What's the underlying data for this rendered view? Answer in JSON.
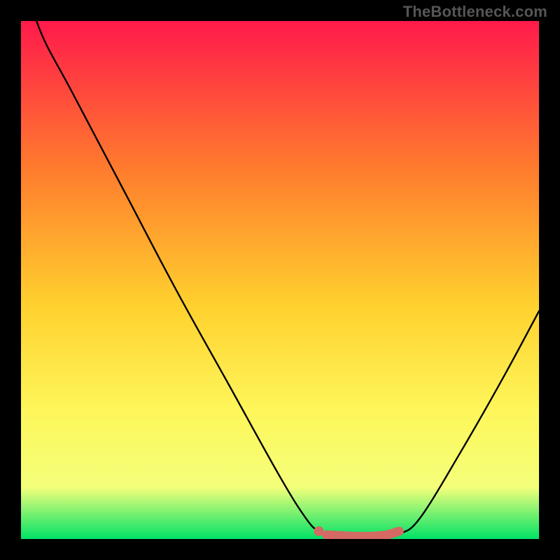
{
  "watermark": "TheBottleneck.com",
  "colors": {
    "frame": "#000000",
    "gradient_top": "#ff1a4b",
    "gradient_mid1": "#ff7a2e",
    "gradient_mid2": "#ffd12e",
    "gradient_mid3": "#fef65a",
    "gradient_mid4": "#f4ff7a",
    "gradient_bottom": "#00e267",
    "curve": "#000000",
    "marker_fill": "#d46a63",
    "marker_stroke": "#d46a63"
  },
  "chart_data": {
    "type": "line",
    "title": "",
    "xlabel": "",
    "ylabel": "",
    "xlim": [
      0,
      1
    ],
    "ylim": [
      0,
      1
    ],
    "grid": false,
    "legend": false,
    "series": [
      {
        "name": "bottleneck-curve",
        "comment": "V-shaped curve; y read as normalized height above plot bottom (0 = bottom, 1 = top)",
        "x": [
          0.0,
          0.03,
          0.1,
          0.2,
          0.3,
          0.4,
          0.5,
          0.55,
          0.575,
          0.6,
          0.65,
          0.7,
          0.73,
          0.77,
          0.85,
          0.93,
          1.0
        ],
        "y": [
          1.15,
          1.0,
          0.86,
          0.67,
          0.48,
          0.3,
          0.12,
          0.04,
          0.015,
          0.01,
          0.005,
          0.005,
          0.01,
          0.04,
          0.17,
          0.31,
          0.44
        ]
      },
      {
        "name": "optimal-segment",
        "comment": "Thick highlighted segment along the valley floor",
        "x": [
          0.59,
          0.65,
          0.7,
          0.73
        ],
        "y": [
          0.008,
          0.005,
          0.007,
          0.015
        ]
      }
    ],
    "markers": [
      {
        "name": "optimal-point",
        "x": 0.575,
        "y": 0.015
      }
    ]
  }
}
